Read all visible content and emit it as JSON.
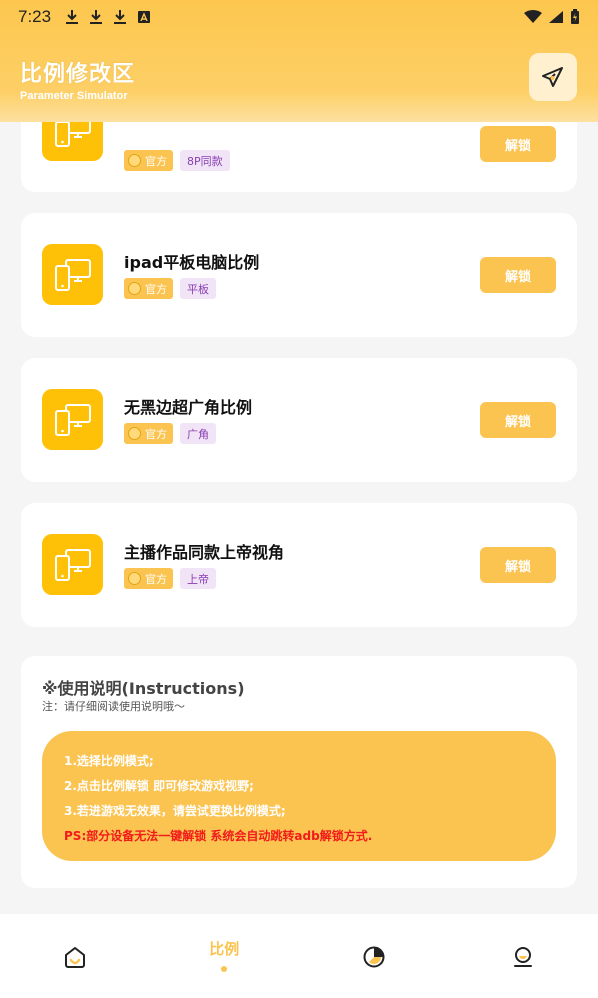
{
  "status_bar": {
    "time": "7:23"
  },
  "header": {
    "title": "比例修改区",
    "subtitle": "Parameter Simulator",
    "send_icon": "paper-plane-icon"
  },
  "cards": [
    {
      "title": "",
      "tag_official": "官方",
      "tag_extra": "8P同款",
      "button": "解锁"
    },
    {
      "title": "ipad平板电脑比例",
      "tag_official": "官方",
      "tag_extra": "平板",
      "button": "解锁"
    },
    {
      "title": "无黑边超广角比例",
      "tag_official": "官方",
      "tag_extra": "广角",
      "button": "解锁"
    },
    {
      "title": "主播作品同款上帝视角",
      "tag_official": "官方",
      "tag_extra": "上帝",
      "button": "解锁"
    }
  ],
  "instructions": {
    "title": "※使用说明(Instructions)",
    "note": "注：请仔细阅读使用说明哦～",
    "lines": [
      "1.选择比例模式;",
      "2.点击比例解锁 即可修改游戏视野;",
      "3.若进游戏无效果，请尝试更换比例模式;"
    ],
    "ps": "PS:部分设备无法一键解锁 系统会自动跳转adb解锁方式."
  },
  "nav": {
    "items": [
      {
        "icon": "home-icon",
        "label": ""
      },
      {
        "icon": "",
        "label": "比例"
      },
      {
        "icon": "pie-chart-icon",
        "label": ""
      },
      {
        "icon": "profile-icon",
        "label": ""
      }
    ]
  },
  "colors": {
    "accent": "#fbc451",
    "icon_bg": "#ffc107",
    "warning": "#f21b1b"
  }
}
